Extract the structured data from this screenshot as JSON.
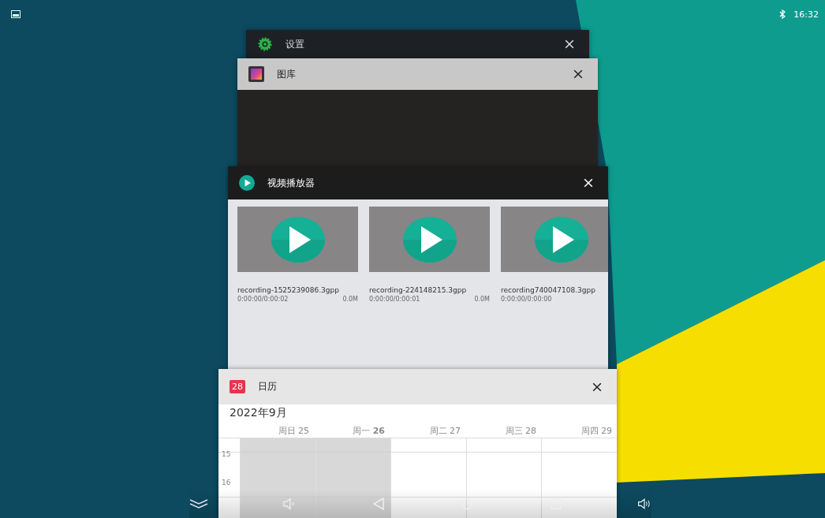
{
  "status_bar": {
    "time": "16:32"
  },
  "recents": [
    {
      "kind": "settings",
      "title": "设置"
    },
    {
      "kind": "gallery",
      "title": "图库"
    },
    {
      "kind": "video",
      "title": "视频播放器",
      "videos": [
        {
          "name": "recording-1525239086.3gpp",
          "duration": "0:00:00/0:00:02",
          "size": "0.0M"
        },
        {
          "name": "recording-224148215.3gpp",
          "duration": "0:00:00/0:00:01",
          "size": "0.0M"
        },
        {
          "name": "recording740047108.3gpp",
          "duration": "0:00:00/0:00:00"
        }
      ]
    },
    {
      "kind": "calendar",
      "title": "日历",
      "icon_text": "28",
      "month": "2022年9月",
      "days": [
        {
          "label": "周日 25",
          "past": true
        },
        {
          "label": "周一 **26**",
          "past": true
        },
        {
          "label": "周二 27",
          "past": false
        },
        {
          "label": "周三 28",
          "past": false
        },
        {
          "label": "周四 29",
          "past": false
        }
      ],
      "hours": [
        "15",
        "16"
      ]
    }
  ]
}
